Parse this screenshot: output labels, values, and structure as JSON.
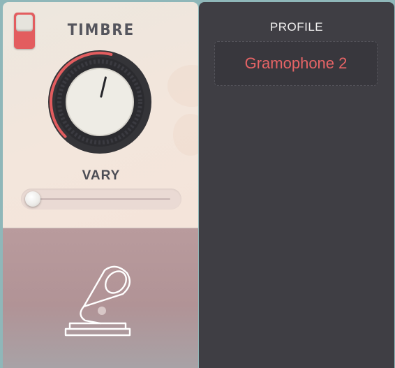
{
  "timbre": {
    "title": "TIMBRE",
    "power_on": true,
    "knob_value": 0.55,
    "vary": {
      "label": "VARY",
      "value": 0.0
    },
    "icon": "gramophone-icon"
  },
  "profile": {
    "label": "PROFILE",
    "selected": "Gramophone 2"
  },
  "colors": {
    "accent": "#e35d5f",
    "panel_dark": "#3f3e44",
    "text_dark": "#55555d"
  }
}
